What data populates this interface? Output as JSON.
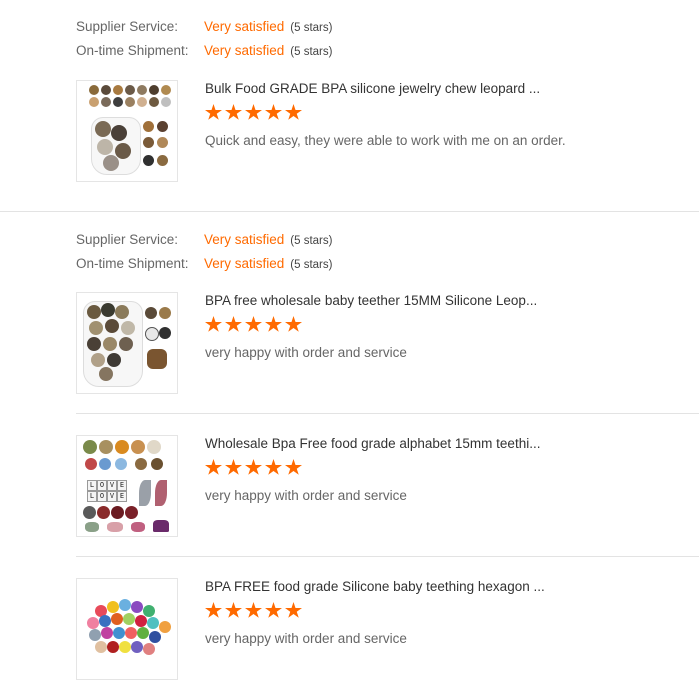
{
  "reviews": [
    {
      "supplier_service_label": "Supplier Service:",
      "supplier_service_value": "Very satisfied",
      "supplier_service_stars": "(5 stars)",
      "shipment_label": "On-time Shipment:",
      "shipment_value": "Very satisfied",
      "shipment_stars": "(5 stars)",
      "items": [
        {
          "title": "Bulk Food GRADE BPA silicone jewelry chew leopard ...",
          "rating": 5,
          "comment": "Quick and easy, they were able to work with me on an order."
        }
      ]
    },
    {
      "supplier_service_label": "Supplier Service:",
      "supplier_service_value": "Very satisfied",
      "supplier_service_stars": "(5 stars)",
      "shipment_label": "On-time Shipment:",
      "shipment_value": "Very satisfied",
      "shipment_stars": "(5 stars)",
      "items": [
        {
          "title": "BPA free wholesale baby teether 15MM Silicone Leop...",
          "rating": 5,
          "comment": "very happy with order and service"
        },
        {
          "title": "Wholesale Bpa Free food grade alphabet 15mm teethi...",
          "rating": 5,
          "comment": "very happy with order and service"
        },
        {
          "title": "BPA FREE food grade Silicone baby teething hexagon ...",
          "rating": 5,
          "comment": "very happy with order and service"
        }
      ]
    }
  ],
  "letter_tiles": [
    "L",
    "O",
    "V",
    "E",
    "L",
    "O",
    "V",
    "E"
  ],
  "colors": {
    "accent": "#ff6a00",
    "divider": "#e3e3e3",
    "label": "#666666"
  }
}
